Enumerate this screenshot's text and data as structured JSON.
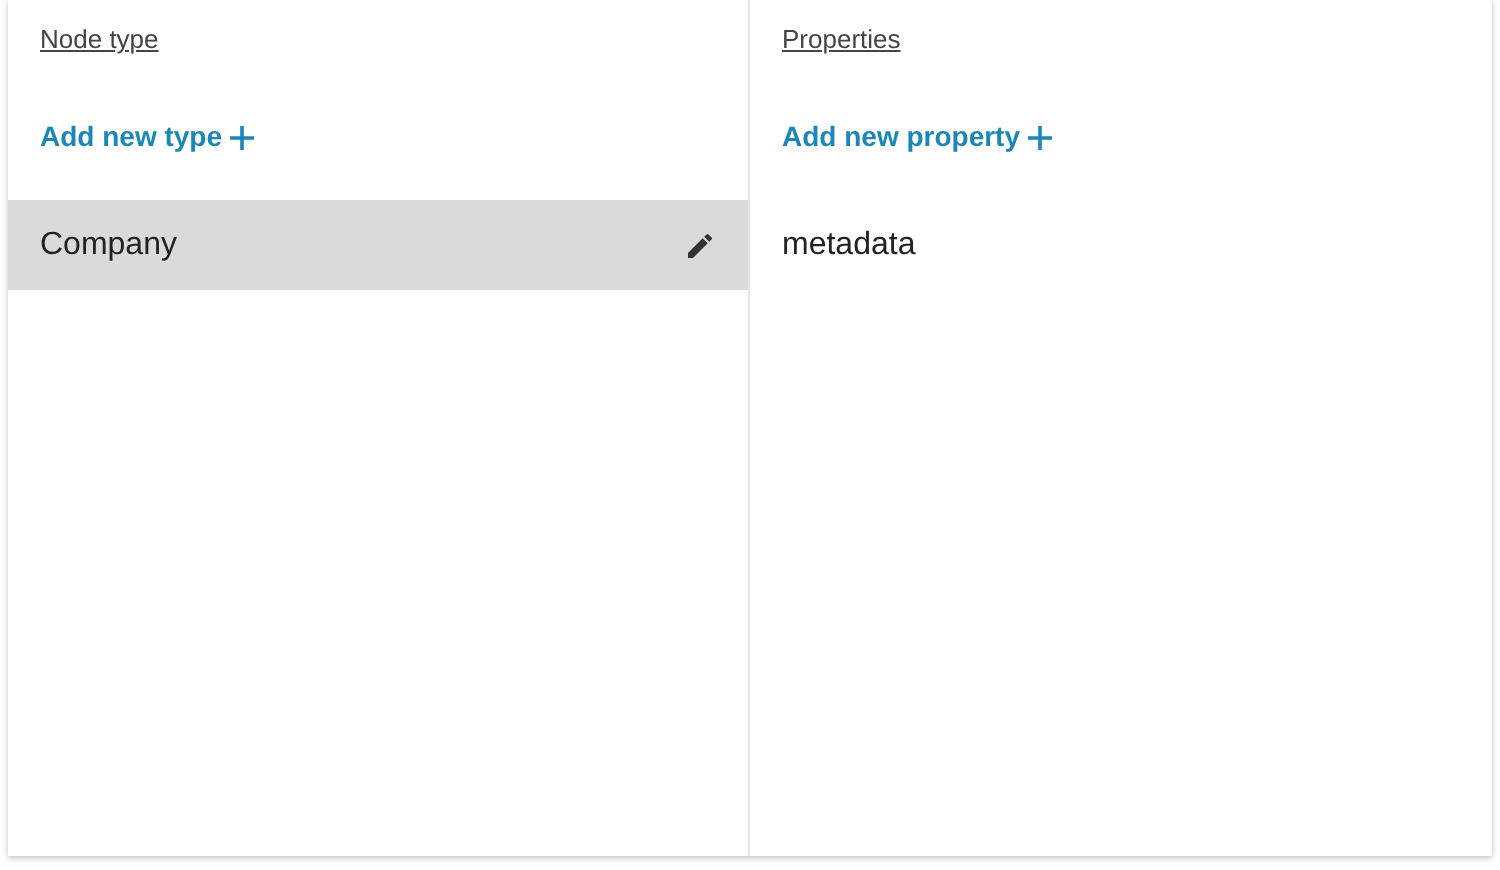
{
  "columns": [
    {
      "heading": "Node type",
      "add_link": "Add new type",
      "items": [
        {
          "label": "Company",
          "selected": true,
          "editable": true
        }
      ]
    },
    {
      "heading": "Properties",
      "add_link": "Add new property",
      "items": [
        {
          "label": "metadata",
          "selected": false,
          "editable": false
        }
      ]
    }
  ]
}
